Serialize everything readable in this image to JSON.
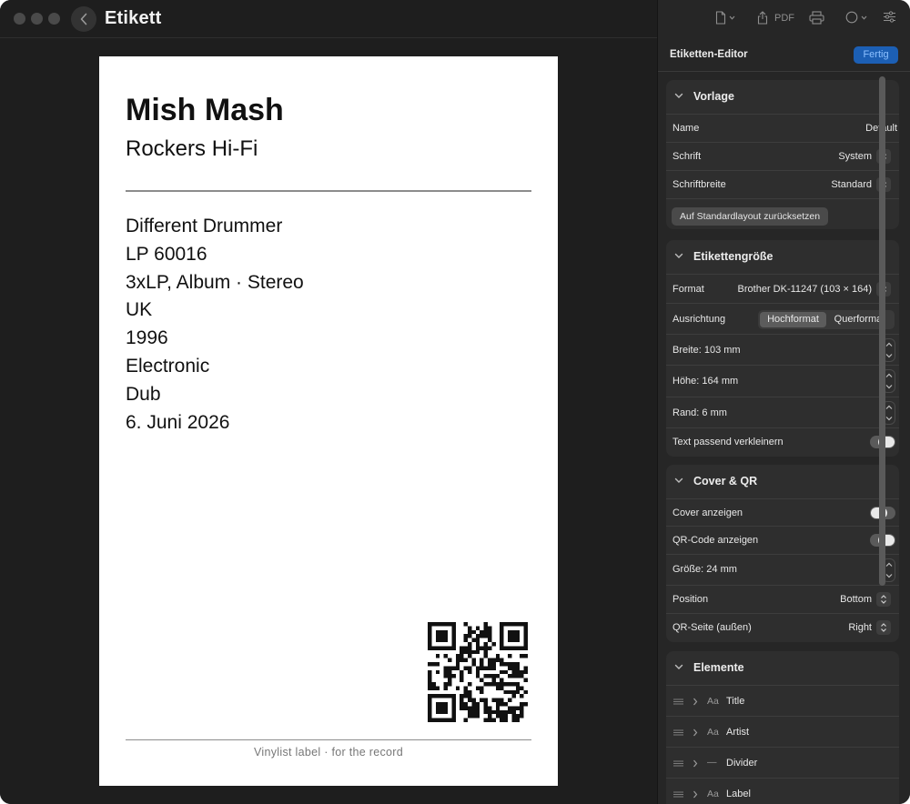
{
  "window": {
    "app_title": "Etikett"
  },
  "toolbar": {
    "pdf_label": "PDF"
  },
  "label": {
    "title": "Mish Mash",
    "artist": "Rockers Hi-Fi",
    "lines": [
      "Different Drummer",
      "LP 60016",
      "3xLP, Album · Stereo",
      "UK",
      "1996",
      "Electronic",
      "Dub",
      "6. Juni 2026"
    ],
    "footer": "Vinylist label · for the record"
  },
  "editor": {
    "title": "Etiketten-Editor",
    "done_label": "Fertig"
  },
  "vorlage": {
    "title": "Vorlage",
    "name_label": "Name",
    "name_value": "Default",
    "font_label": "Schrift",
    "font_value": "System",
    "width_label": "Schriftbreite",
    "width_value": "Standard",
    "reset_label": "Auf Standardlayout zurücksetzen"
  },
  "size": {
    "title": "Etikettengröße",
    "format_label": "Format",
    "format_value": "Brother DK-11247 (103 × 164)",
    "orientation_label": "Ausrichtung",
    "orientation_options": [
      "Hochformat",
      "Querformat"
    ],
    "orientation_selected": "Hochformat",
    "width": "Breite: 103 mm",
    "height": "Höhe: 164 mm",
    "margin": "Rand: 6 mm",
    "shrink_label": "Text passend verkleinern",
    "shrink_on": true
  },
  "cover_qr": {
    "title": "Cover & QR",
    "show_cover_label": "Cover anzeigen",
    "show_cover_on": false,
    "show_qr_label": "QR-Code anzeigen",
    "show_qr_on": true,
    "qr_size": "Größe: 24 mm",
    "position_label": "Position",
    "position_value": "Bottom",
    "side_label": "QR-Seite (außen)",
    "side_value": "Right"
  },
  "elements": {
    "title": "Elemente",
    "items": [
      {
        "icon": "Aa",
        "name": "Title"
      },
      {
        "icon": "Aa",
        "name": "Artist"
      },
      {
        "icon": "—",
        "name": "Divider"
      },
      {
        "icon": "Aa",
        "name": "Label"
      }
    ]
  }
}
